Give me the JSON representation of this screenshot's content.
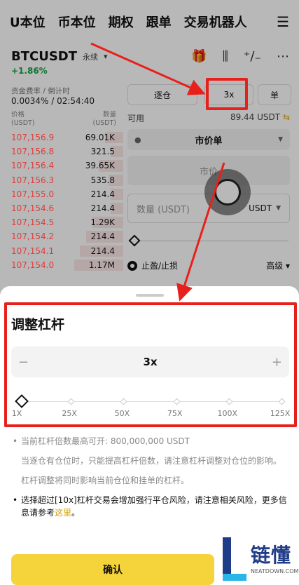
{
  "topnav": {
    "tabs": [
      "U本位",
      "币本位",
      "期权",
      "跟单",
      "交易机器人"
    ],
    "menu_icon": "menu-icon"
  },
  "symbol": {
    "name": "BTCUSDT",
    "type": "永续",
    "change": "+1.86%"
  },
  "funding": {
    "label": "资金费率 / 倒计时",
    "value": "0.0034% / 02:54:40"
  },
  "orderbook": {
    "price_header": "价格\n(USDT)",
    "qty_header": "数量\n(USDT)",
    "price_header_1": "价格",
    "price_header_2": "(USDT)",
    "qty_header_1": "数量",
    "qty_header_2": "(USDT)",
    "rows": [
      {
        "price": "107,156.9",
        "qty": "69.01K",
        "depth": 0.15
      },
      {
        "price": "107,156.8",
        "qty": "321.5",
        "depth": 0.1
      },
      {
        "price": "107,156.4",
        "qty": "39.65K",
        "depth": 0.2
      },
      {
        "price": "107,156.3",
        "qty": "535.8",
        "depth": 0.12
      },
      {
        "price": "107,155.0",
        "qty": "214.4",
        "depth": 0.1
      },
      {
        "price": "107,154.6",
        "qty": "214.4",
        "depth": 0.1
      },
      {
        "price": "107,154.5",
        "qty": "1.29K",
        "depth": 0.25
      },
      {
        "price": "107,154.2",
        "qty": "214.4",
        "depth": 0.3
      },
      {
        "price": "107,154.1",
        "qty": "214.4",
        "depth": 0.35
      },
      {
        "price": "107,154.0",
        "qty": "1.17M",
        "depth": 0.4
      }
    ]
  },
  "trade_panel": {
    "margin_mode": "逐仓",
    "leverage": "3x",
    "mode_extra": "单",
    "available_label": "可用",
    "available_value": "89.44 USDT",
    "order_type": "市价单",
    "price_placeholder": "市价",
    "qty_placeholder": "数量 (USDT)",
    "qty_unit": "USDT",
    "tpsl_label": "止盈/止损",
    "advanced_label": "高级"
  },
  "sheet": {
    "title": "调整杠杆",
    "leverage_value": "3x",
    "minus": "−",
    "plus": "+",
    "slider_ticks": [
      "1X",
      "25X",
      "50X",
      "75X",
      "100X",
      "125X"
    ],
    "slider_value": 3,
    "notes": [
      "当前杠杆倍数最高可开: 800,000,000 USDT",
      "当逐仓有仓位时，只能提高杠杆倍数，请注意杠杆调整对仓位的影响。",
      "杠杆调整将同时影响当前仓位和挂单的杠杆。"
    ],
    "warning": "选择超过[10x]杠杆交易会增加强行平仓风险，请注意相关风险，更多信息请参考",
    "warning_link": "这里",
    "warning_end": "。",
    "confirm": "确认"
  },
  "watermark": {
    "text": "链懂",
    "sub": "NEATDOWN.COM"
  },
  "colors": {
    "accent": "#f5d33a",
    "ask": "#e23a3a",
    "bid": "#16a34a",
    "annotation": "#e8201c"
  }
}
